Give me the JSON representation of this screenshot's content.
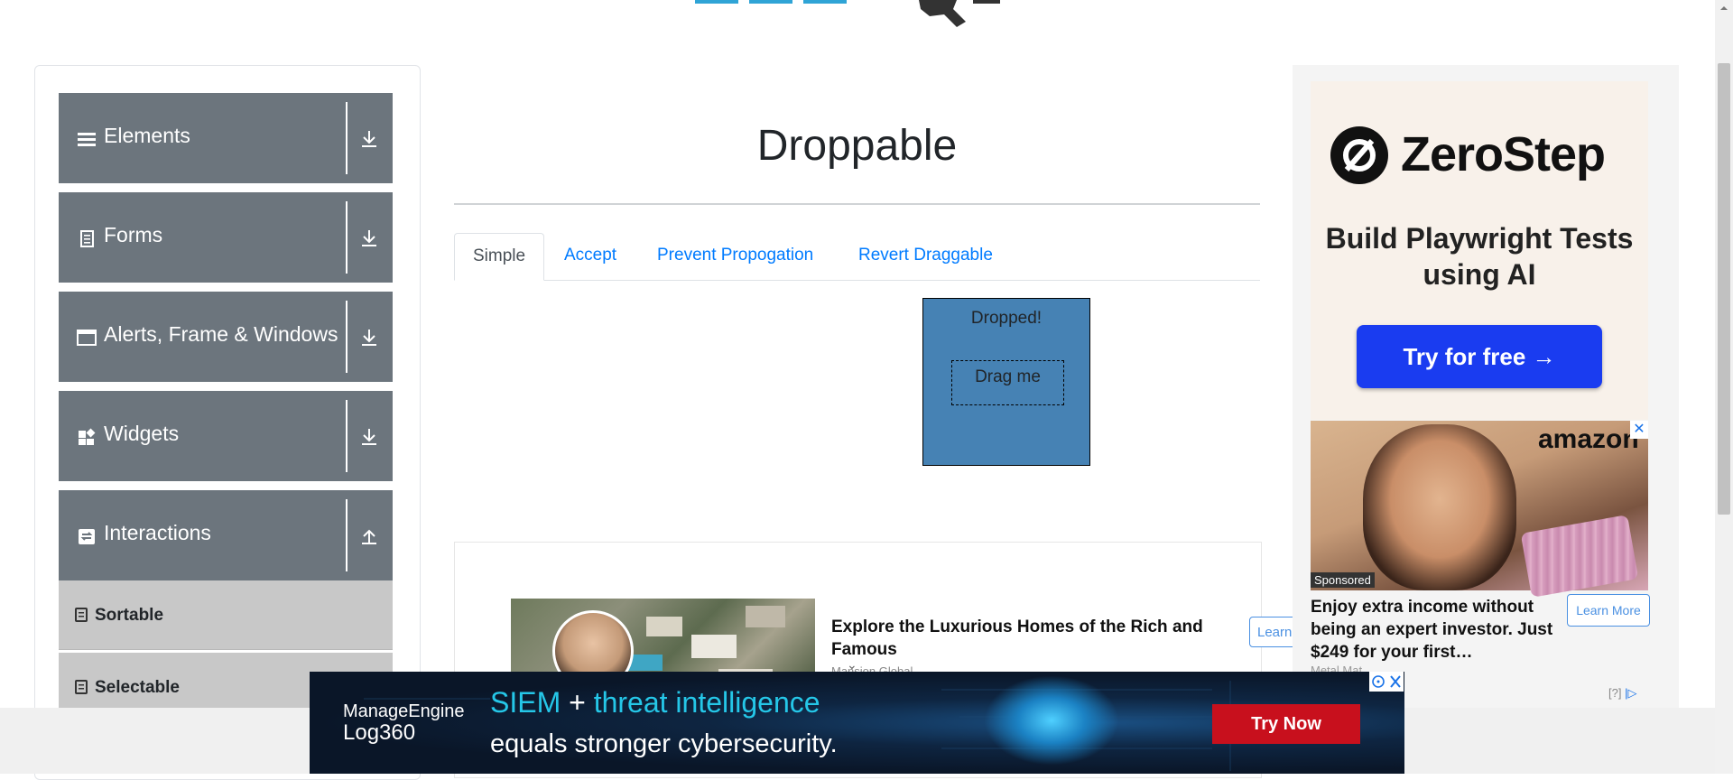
{
  "sidebar": {
    "groups": [
      {
        "label": "Elements",
        "icon": "hamburger-icon",
        "arrow": "download-arrow-icon"
      },
      {
        "label": "Forms",
        "icon": "document-icon",
        "arrow": "download-arrow-icon"
      },
      {
        "label": "Alerts, Frame & Windows",
        "icon": "window-icon",
        "arrow": "download-arrow-icon"
      },
      {
        "label": "Widgets",
        "icon": "widgets-icon",
        "arrow": "download-arrow-icon"
      },
      {
        "label": "Interactions",
        "icon": "interactions-icon",
        "arrow": "upload-arrow-icon"
      }
    ],
    "subitems": [
      {
        "label": "Sortable"
      },
      {
        "label": "Selectable"
      }
    ]
  },
  "main": {
    "title": "Droppable",
    "tabs": [
      {
        "label": "Simple",
        "active": true
      },
      {
        "label": "Accept",
        "active": false
      },
      {
        "label": "Prevent Propogation",
        "active": false
      },
      {
        "label": "Revert Draggable",
        "active": false
      }
    ],
    "drop_target": {
      "text": "Dropped!",
      "color": "#4682b4"
    },
    "draggable": {
      "text": "Drag me"
    }
  },
  "inline_ad": {
    "headline": "Explore the Luxurious Homes of the Rich and Famous",
    "source": "Mansion Global",
    "button": "Learn"
  },
  "right_ad": {
    "brand": "ZeroStep",
    "tagline": "Build Playwright Tests using AI",
    "cta": "Try for free →",
    "amazon_logo": "amazon",
    "sponsored": "Sponsored",
    "body": "Enjoy extra income without being an expert investor. Just $249 for your first…",
    "button": "Learn More",
    "source": "Metal Mat",
    "adchoice": "[?]"
  },
  "banner": {
    "brand": "ManageEngine",
    "product": "Log360",
    "line1_a": "SIEM",
    "line1_plus": "+",
    "line1_b": "threat intelligence",
    "line2": "equals stronger cybersecurity.",
    "cta": "Try Now",
    "cta_color": "#c8101d"
  },
  "colors": {
    "sidebar_group_bg": "#6c757d",
    "sidebar_subitem_bg": "#c8c8c8",
    "link": "#007bff"
  }
}
